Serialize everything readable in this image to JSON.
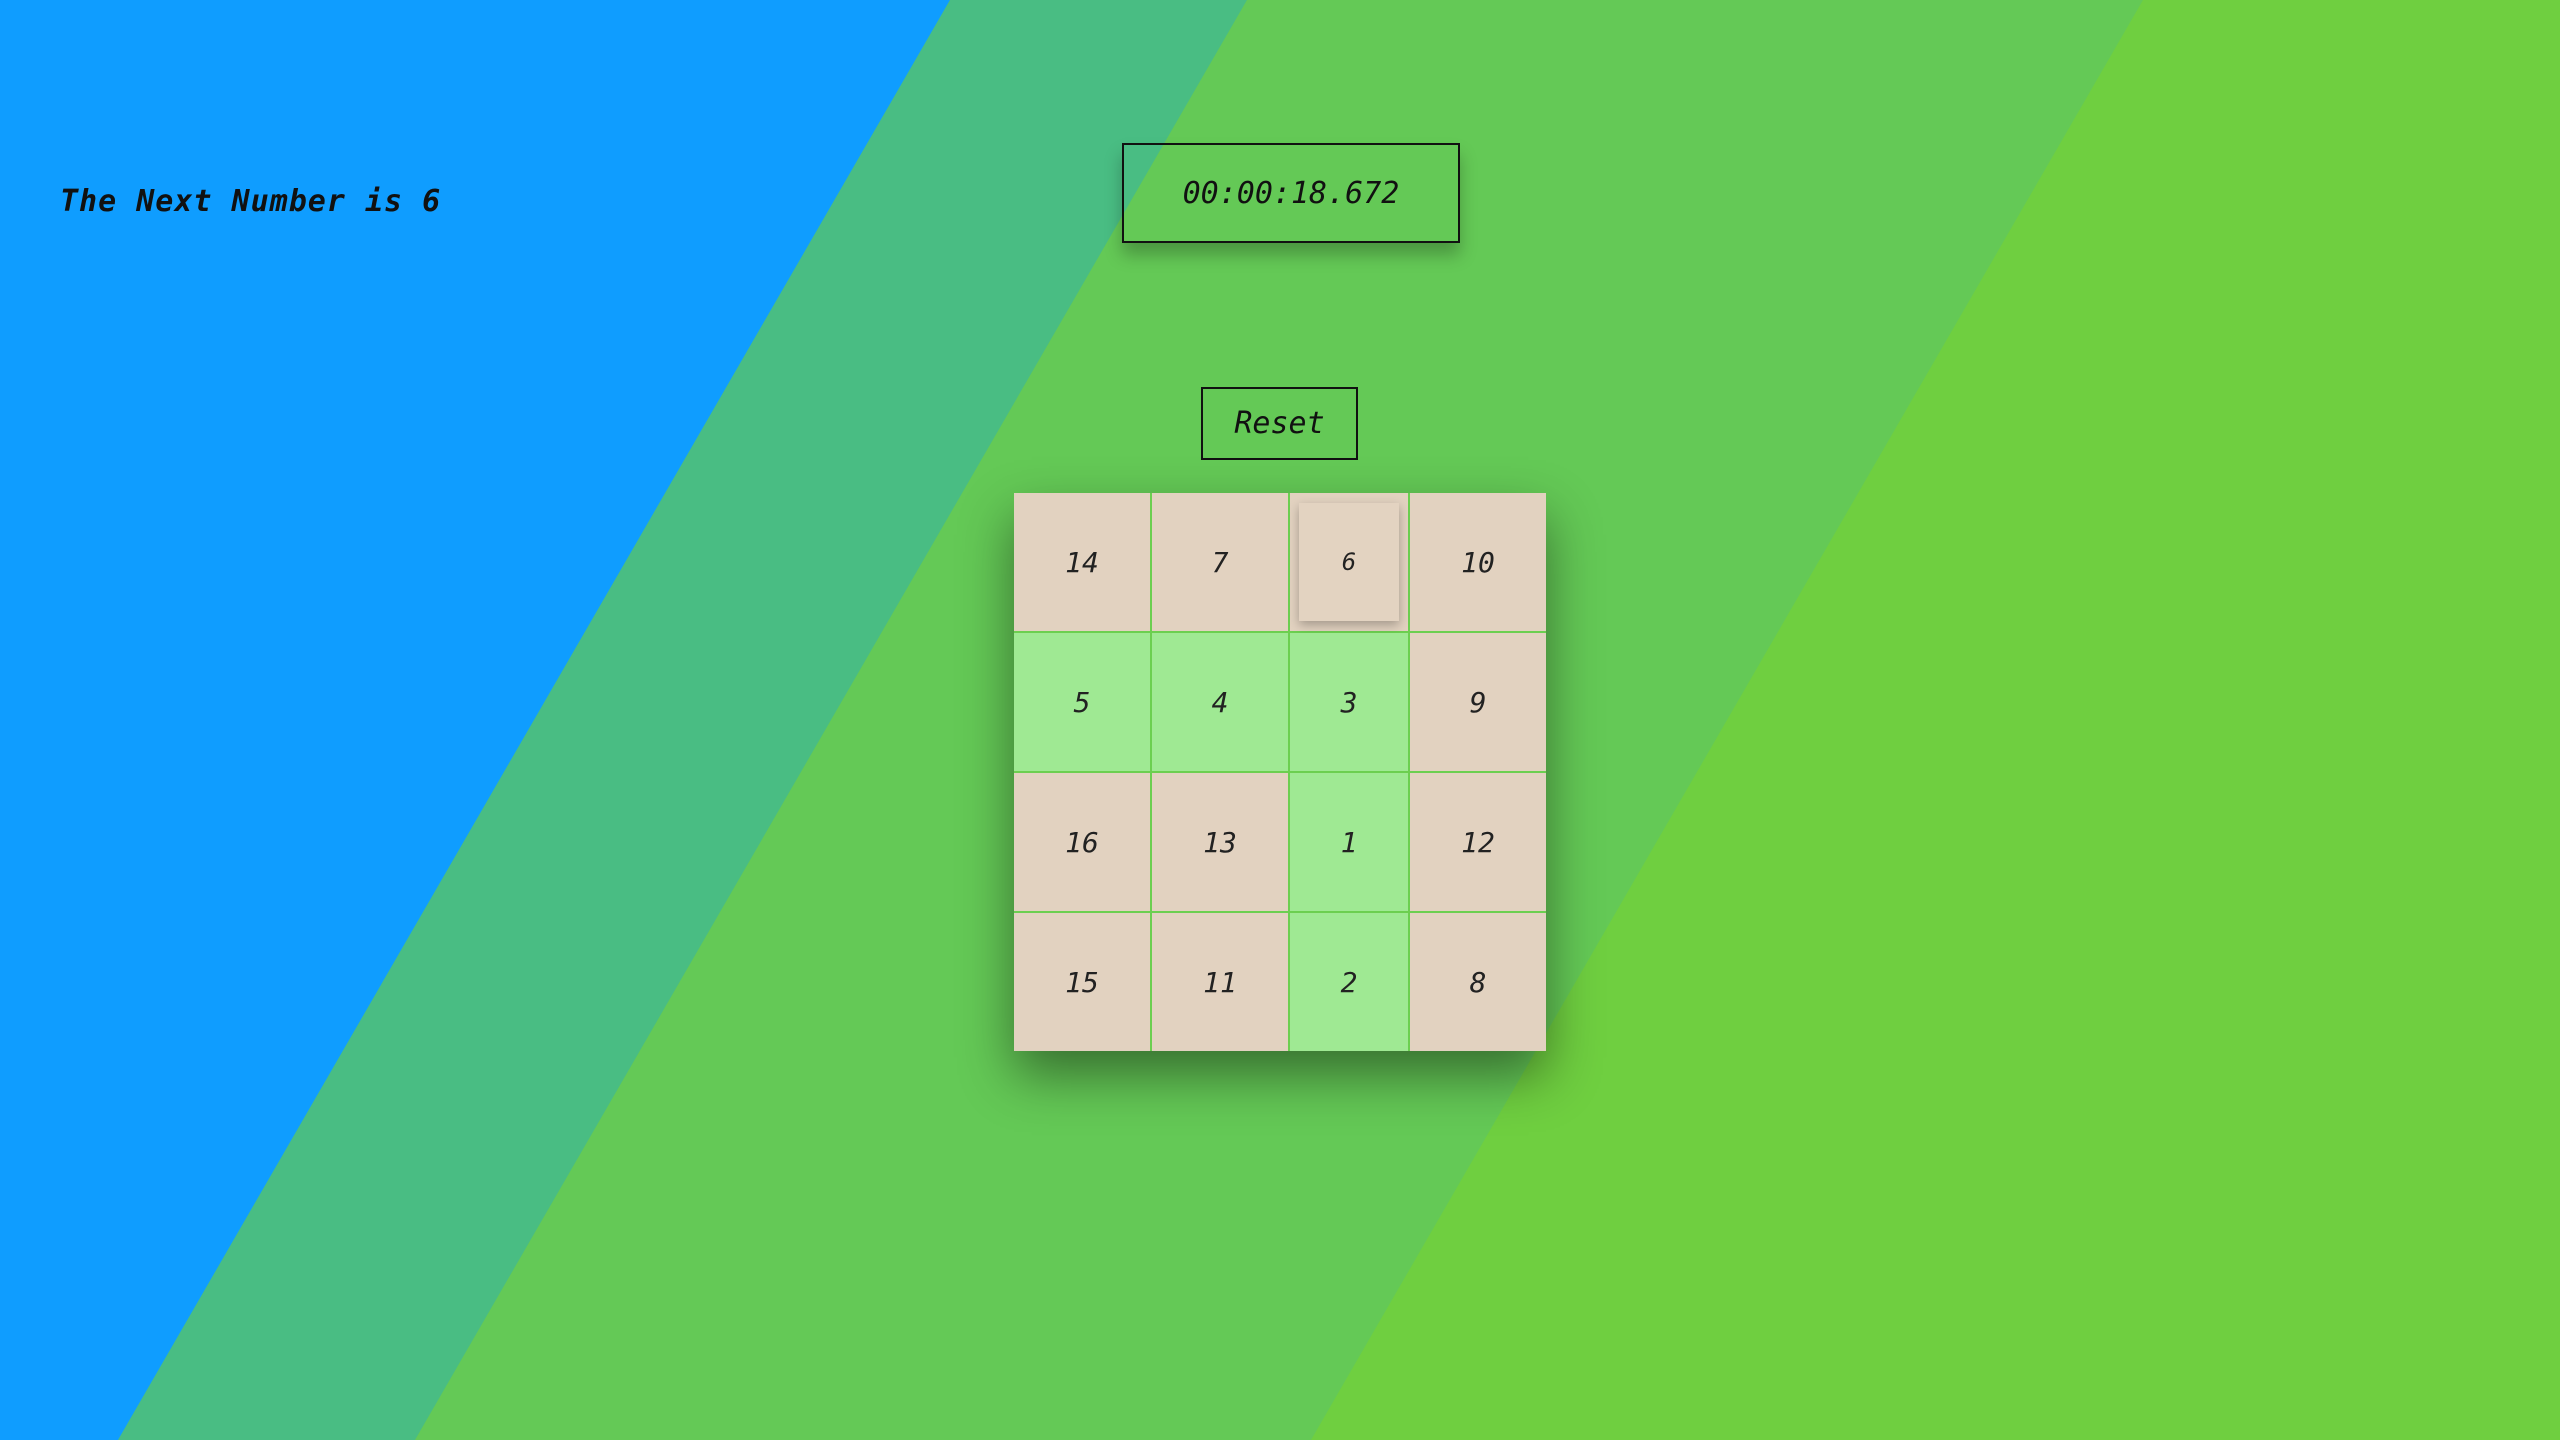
{
  "status": {
    "next_number_text": "The Next Number is 6"
  },
  "timer": {
    "value": "00:00:18.672"
  },
  "controls": {
    "reset_label": "Reset"
  },
  "board": {
    "rows": 4,
    "cols": 4,
    "next_number": 6,
    "cells": [
      {
        "label": "14",
        "state": "pending"
      },
      {
        "label": "7",
        "state": "pending"
      },
      {
        "label": "6",
        "state": "active"
      },
      {
        "label": "10",
        "state": "pending"
      },
      {
        "label": "5",
        "state": "done"
      },
      {
        "label": "4",
        "state": "done"
      },
      {
        "label": "3",
        "state": "done"
      },
      {
        "label": "9",
        "state": "pending"
      },
      {
        "label": "16",
        "state": "pending"
      },
      {
        "label": "13",
        "state": "pending"
      },
      {
        "label": "1",
        "state": "done"
      },
      {
        "label": "12",
        "state": "pending"
      },
      {
        "label": "15",
        "state": "pending"
      },
      {
        "label": "11",
        "state": "pending"
      },
      {
        "label": "2",
        "state": "done"
      },
      {
        "label": "8",
        "state": "pending"
      }
    ]
  },
  "colors": {
    "background_blue": "#0f9dff",
    "background_teal": "#49bd83",
    "background_green": "#64c956",
    "background_green_bright": "#6fcf40",
    "tile_pending": "#e2d2c0",
    "tile_done": "#9fe993",
    "grid_line": "#6ccf50"
  }
}
